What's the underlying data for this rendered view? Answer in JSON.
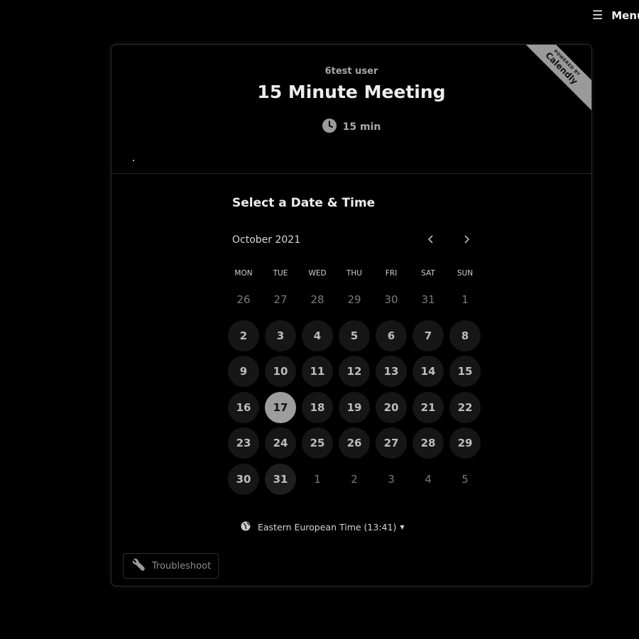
{
  "top_menu": {
    "label": "Menu",
    "icon": "hamburger-icon",
    "glyph": "☰"
  },
  "ribbon": {
    "powered_by": "POWERED BY",
    "brand": "Calendly"
  },
  "header": {
    "host": "6test user",
    "title": "15 Minute Meeting",
    "duration": "15 min",
    "duration_icon": "clock-icon"
  },
  "scheduler": {
    "title": "Select a Date & Time",
    "month": "October 2021",
    "weekdays": [
      "MON",
      "TUE",
      "WED",
      "THU",
      "FRI",
      "SAT",
      "SUN"
    ],
    "days": [
      {
        "label": "26",
        "state": "disabled"
      },
      {
        "label": "27",
        "state": "disabled"
      },
      {
        "label": "28",
        "state": "disabled"
      },
      {
        "label": "29",
        "state": "disabled"
      },
      {
        "label": "30",
        "state": "disabled"
      },
      {
        "label": "31",
        "state": "disabled"
      },
      {
        "label": "1",
        "state": "disabled"
      },
      {
        "label": "2",
        "state": "available"
      },
      {
        "label": "3",
        "state": "available"
      },
      {
        "label": "4",
        "state": "available"
      },
      {
        "label": "5",
        "state": "available"
      },
      {
        "label": "6",
        "state": "available"
      },
      {
        "label": "7",
        "state": "available"
      },
      {
        "label": "8",
        "state": "available"
      },
      {
        "label": "9",
        "state": "available"
      },
      {
        "label": "10",
        "state": "available"
      },
      {
        "label": "11",
        "state": "available"
      },
      {
        "label": "12",
        "state": "available"
      },
      {
        "label": "13",
        "state": "available"
      },
      {
        "label": "14",
        "state": "available"
      },
      {
        "label": "15",
        "state": "available"
      },
      {
        "label": "16",
        "state": "available"
      },
      {
        "label": "17",
        "state": "selected"
      },
      {
        "label": "18",
        "state": "available"
      },
      {
        "label": "19",
        "state": "available"
      },
      {
        "label": "20",
        "state": "available"
      },
      {
        "label": "21",
        "state": "available"
      },
      {
        "label": "22",
        "state": "available"
      },
      {
        "label": "23",
        "state": "available"
      },
      {
        "label": "24",
        "state": "available"
      },
      {
        "label": "25",
        "state": "available"
      },
      {
        "label": "26",
        "state": "available"
      },
      {
        "label": "27",
        "state": "available"
      },
      {
        "label": "28",
        "state": "available"
      },
      {
        "label": "29",
        "state": "available"
      },
      {
        "label": "30",
        "state": "available"
      },
      {
        "label": "31",
        "state": "available-soft"
      },
      {
        "label": "1",
        "state": "disabled"
      },
      {
        "label": "2",
        "state": "disabled"
      },
      {
        "label": "3",
        "state": "disabled"
      },
      {
        "label": "4",
        "state": "disabled"
      },
      {
        "label": "5",
        "state": "disabled"
      }
    ],
    "timezone": "Eastern European Time (13:41)",
    "timezone_icon": "globe-icon"
  },
  "troubleshoot": {
    "label": "Troubleshoot",
    "icon": "wrench-icon"
  }
}
